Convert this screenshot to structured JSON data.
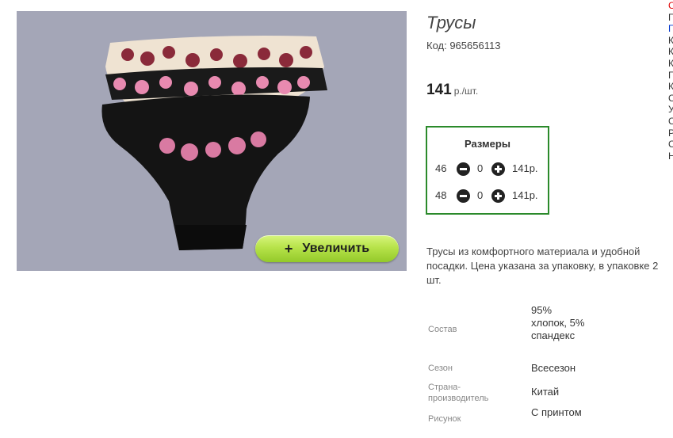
{
  "product": {
    "title": "Трусы",
    "code": "Код: 965656113",
    "price": "141",
    "price_unit": "р./шт.",
    "zoom_button": "Увеличить",
    "zoom_plus": "+",
    "description": "Трусы из комфортного материала и удобной посадки. Цена указана за упаковку, в упаковке 2 шт."
  },
  "sizes": {
    "title": "Размеры",
    "rows": [
      {
        "size": "46",
        "qty": "0",
        "price": "141р."
      },
      {
        "size": "48",
        "qty": "0",
        "price": "141р."
      }
    ]
  },
  "specs": [
    {
      "label": "Состав",
      "value": "95% хлопок, 5% спандекс"
    },
    {
      "label": "Сезон",
      "value": "Всесезон"
    },
    {
      "label": "Страна-производитель",
      "value": "Китай"
    },
    {
      "label": "Рисунок",
      "value": "С принтом"
    }
  ],
  "side_links": [
    "С",
    "Г",
    "Г",
    "К",
    "К",
    "К",
    "Г",
    "К",
    "С",
    "У",
    "С",
    "Р",
    "С",
    "Н"
  ],
  "colors": {
    "frame_border": "#2b8a2b",
    "zoom_button": "#b7e34a",
    "image_background": "#a4a6b7",
    "side_link_red": "#e00000",
    "side_link_blue": "#0033cc"
  }
}
